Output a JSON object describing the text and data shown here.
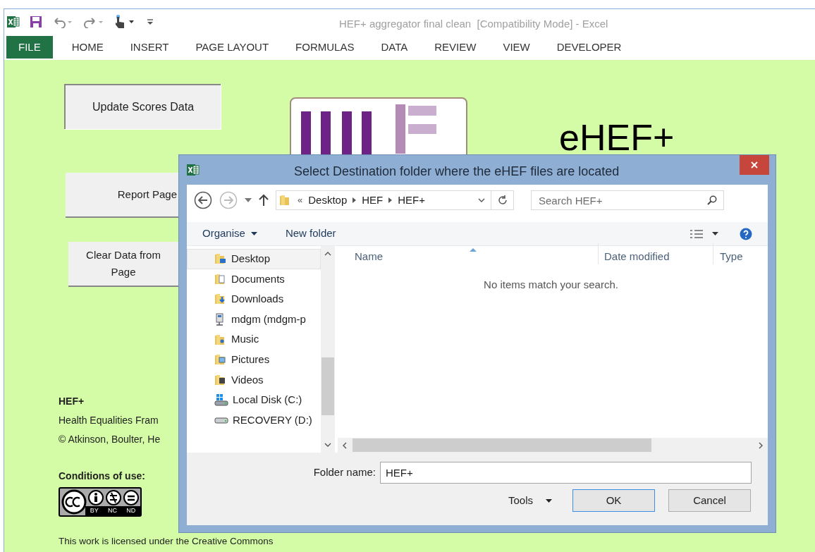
{
  "window": {
    "title": "HEF+ aggregator final clean  [Compatibility Mode] - Excel"
  },
  "ribbon_tabs": [
    {
      "label": "FILE",
      "selected": true
    },
    {
      "label": "HOME",
      "selected": false
    },
    {
      "label": "INSERT",
      "selected": false
    },
    {
      "label": "PAGE LAYOUT",
      "selected": false
    },
    {
      "label": "FORMULAS",
      "selected": false
    },
    {
      "label": "DATA",
      "selected": false
    },
    {
      "label": "REVIEW",
      "selected": false
    },
    {
      "label": "VIEW",
      "selected": false
    },
    {
      "label": "DEVELOPER",
      "selected": false
    }
  ],
  "sheet": {
    "buttons": [
      "Update Scores Data",
      "Report Page",
      "Clear Data from\nPage"
    ],
    "heading": "eHEF+",
    "info_title": "HEF+",
    "info_lines": [
      "Health Equalities Fram",
      "© Atkinson, Boulter, He"
    ],
    "conditions_title": "Conditions of use:",
    "license_badge": [
      "BY",
      "NC",
      "ND"
    ],
    "license_text": "This work is licensed under the Creative Commons"
  },
  "dialog": {
    "title": "Select Destination folder where the eHEF files are located",
    "path_prefix": "«",
    "path": [
      "Desktop",
      "HEF",
      "HEF+"
    ],
    "search_placeholder": "Search HEF+",
    "toolbar": [
      "Organise",
      "New folder"
    ],
    "nav_items": [
      {
        "label": "Desktop",
        "kind": "desktop",
        "selected": true
      },
      {
        "label": "Documents",
        "kind": "documents",
        "selected": false
      },
      {
        "label": "Downloads",
        "kind": "downloads",
        "selected": false
      },
      {
        "label": "mdgm (mdgm-p",
        "kind": "network",
        "selected": false
      },
      {
        "label": "Music",
        "kind": "music",
        "selected": false
      },
      {
        "label": "Pictures",
        "kind": "pictures",
        "selected": false
      },
      {
        "label": "Videos",
        "kind": "videos",
        "selected": false
      },
      {
        "label": "Local Disk (C:)",
        "kind": "system-disk",
        "selected": false
      },
      {
        "label": "RECOVERY (D:)",
        "kind": "disk",
        "selected": false
      }
    ],
    "columns": [
      "Name",
      "Date modified",
      "Type"
    ],
    "empty_message": "No items match your search.",
    "folder_name_label": "Folder name:",
    "folder_name": "HEF+",
    "tools_label": "Tools",
    "buttons": [
      {
        "label": "OK",
        "default": true
      },
      {
        "label": "Cancel",
        "default": false
      }
    ]
  }
}
